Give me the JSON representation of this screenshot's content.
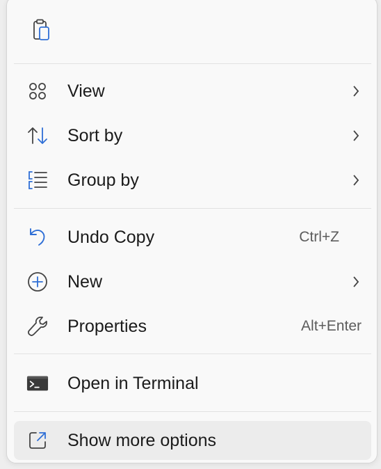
{
  "toolbar": {
    "paste_icon": "paste-icon"
  },
  "menu": {
    "view": {
      "label": "View",
      "icon": "view-grid-icon"
    },
    "sort_by": {
      "label": "Sort by",
      "icon": "sort-arrows-icon"
    },
    "group_by": {
      "label": "Group by",
      "icon": "group-list-icon"
    },
    "undo_copy": {
      "label": "Undo Copy",
      "shortcut": "Ctrl+Z",
      "icon": "undo-icon"
    },
    "new": {
      "label": "New",
      "icon": "add-circle-icon"
    },
    "properties": {
      "label": "Properties",
      "shortcut": "Alt+Enter",
      "icon": "wrench-icon"
    },
    "open_terminal": {
      "label": "Open in Terminal",
      "icon": "terminal-icon"
    },
    "show_more": {
      "label": "Show more options",
      "icon": "share-expand-icon"
    }
  },
  "colors": {
    "accent": "#2f6fd6",
    "icon_dark": "#444444",
    "text": "#1b1b1b",
    "shortcut": "#5c5c5c"
  }
}
